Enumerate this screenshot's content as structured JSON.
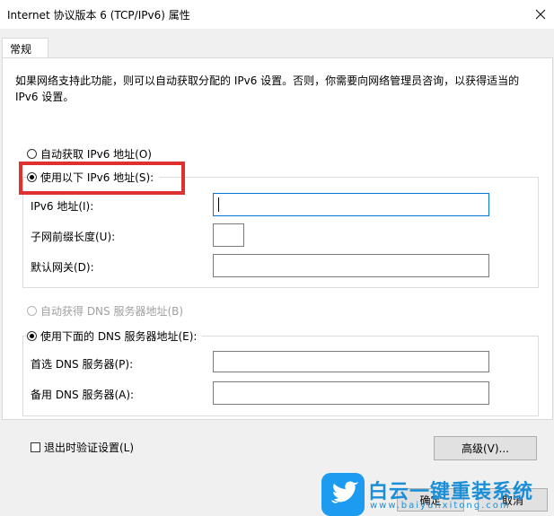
{
  "window": {
    "title": "Internet 协议版本 6 (TCP/IPv6) 属性",
    "close_icon": "close-icon"
  },
  "tabs": [
    {
      "label": "常规",
      "selected": true
    }
  ],
  "description": "如果网络支持此功能，则可以自动获取分配的 IPv6 设置。否则，你需要向网络管理员咨询，以获得适当的 IPv6 设置。",
  "ip_section": {
    "auto_radio_label": "自动获取 IPv6 地址(O)",
    "manual_radio_label": "使用以下 IPv6 地址(S):",
    "selected": "manual",
    "ipv6_address_label": "IPv6 地址(I):",
    "ipv6_address_value": "",
    "prefix_length_label": "子网前缀长度(U):",
    "prefix_length_value": "",
    "gateway_label": "默认网关(D):",
    "gateway_value": ""
  },
  "dns_section": {
    "auto_radio_label": "自动获得 DNS 服务器地址(B)",
    "auto_disabled": true,
    "manual_radio_label": "使用下面的 DNS 服务器地址(E):",
    "selected": "manual",
    "preferred_label": "首选 DNS 服务器(P):",
    "preferred_value": "",
    "alternate_label": "备用 DNS 服务器(A):",
    "alternate_value": ""
  },
  "validate_checkbox_label": "退出时验证设置(L)",
  "validate_checked": false,
  "advanced_button_label": "高级(V)...",
  "ok_button_label": "确定",
  "cancel_button_label": "取消",
  "watermark": {
    "brand_text": "白云一键重装系统",
    "url_text": "www.baiyunxitong.com"
  },
  "colors": {
    "highlight": "#e03131",
    "focus_border": "#0078d7",
    "watermark_blue": "#1a8fd8"
  }
}
